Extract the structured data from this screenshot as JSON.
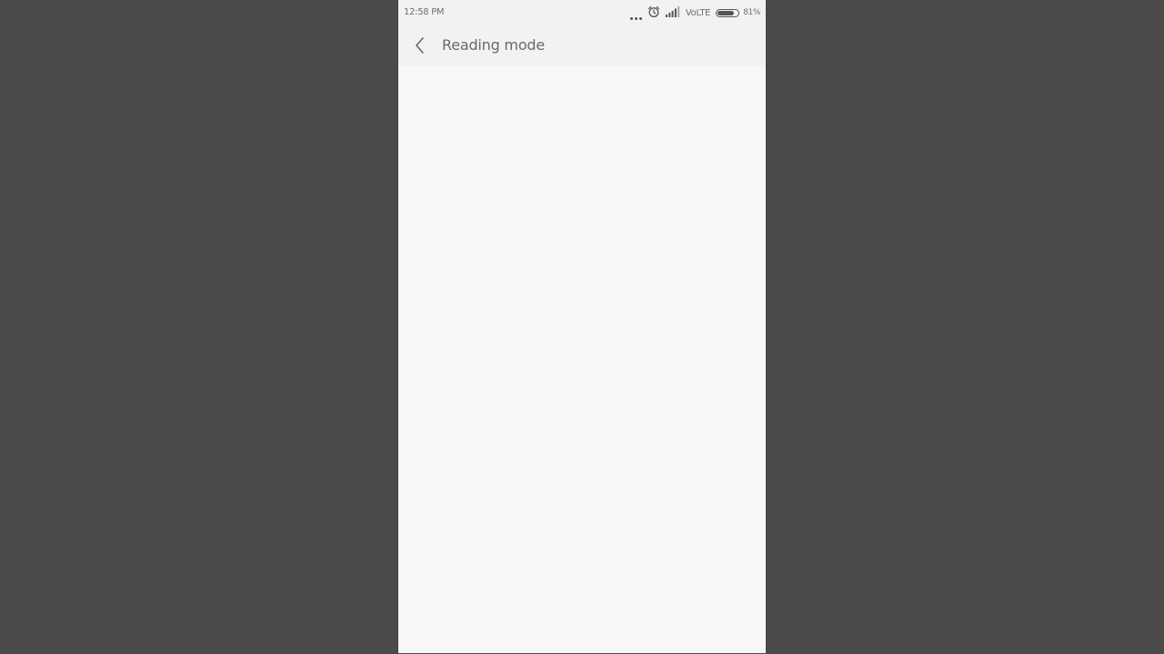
{
  "status_bar": {
    "time": "12:58 PM",
    "network_label": "VoLTE",
    "battery_percent": "81%",
    "battery_level": 0.81,
    "icons": [
      "more-dots-icon",
      "alarm-icon",
      "signal-icon",
      "battery-icon"
    ]
  },
  "action_bar": {
    "back_icon": "chevron-left-icon",
    "title": "Reading mode"
  },
  "colors": {
    "backdrop": "#4a4a4a",
    "bar_background": "#f2f2f2",
    "content_background": "#f7f7f7",
    "text": "#6a6a6a"
  }
}
